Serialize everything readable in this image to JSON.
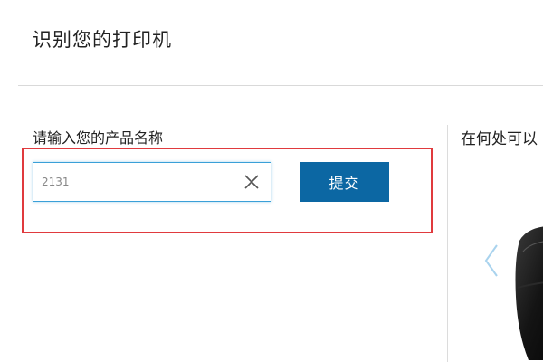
{
  "header": {
    "title": "识别您的打印机"
  },
  "form": {
    "label": "请输入您的产品名称",
    "input_value": "2131",
    "submit_label": "提交"
  },
  "side_panel": {
    "title": "在何处可以"
  },
  "icons": {
    "clear": "close-icon",
    "prev": "chevron-left-icon"
  },
  "colors": {
    "primary_button": "#0c67a3",
    "highlight_border": "#e03a3e",
    "input_focus": "#3aa0d8"
  }
}
